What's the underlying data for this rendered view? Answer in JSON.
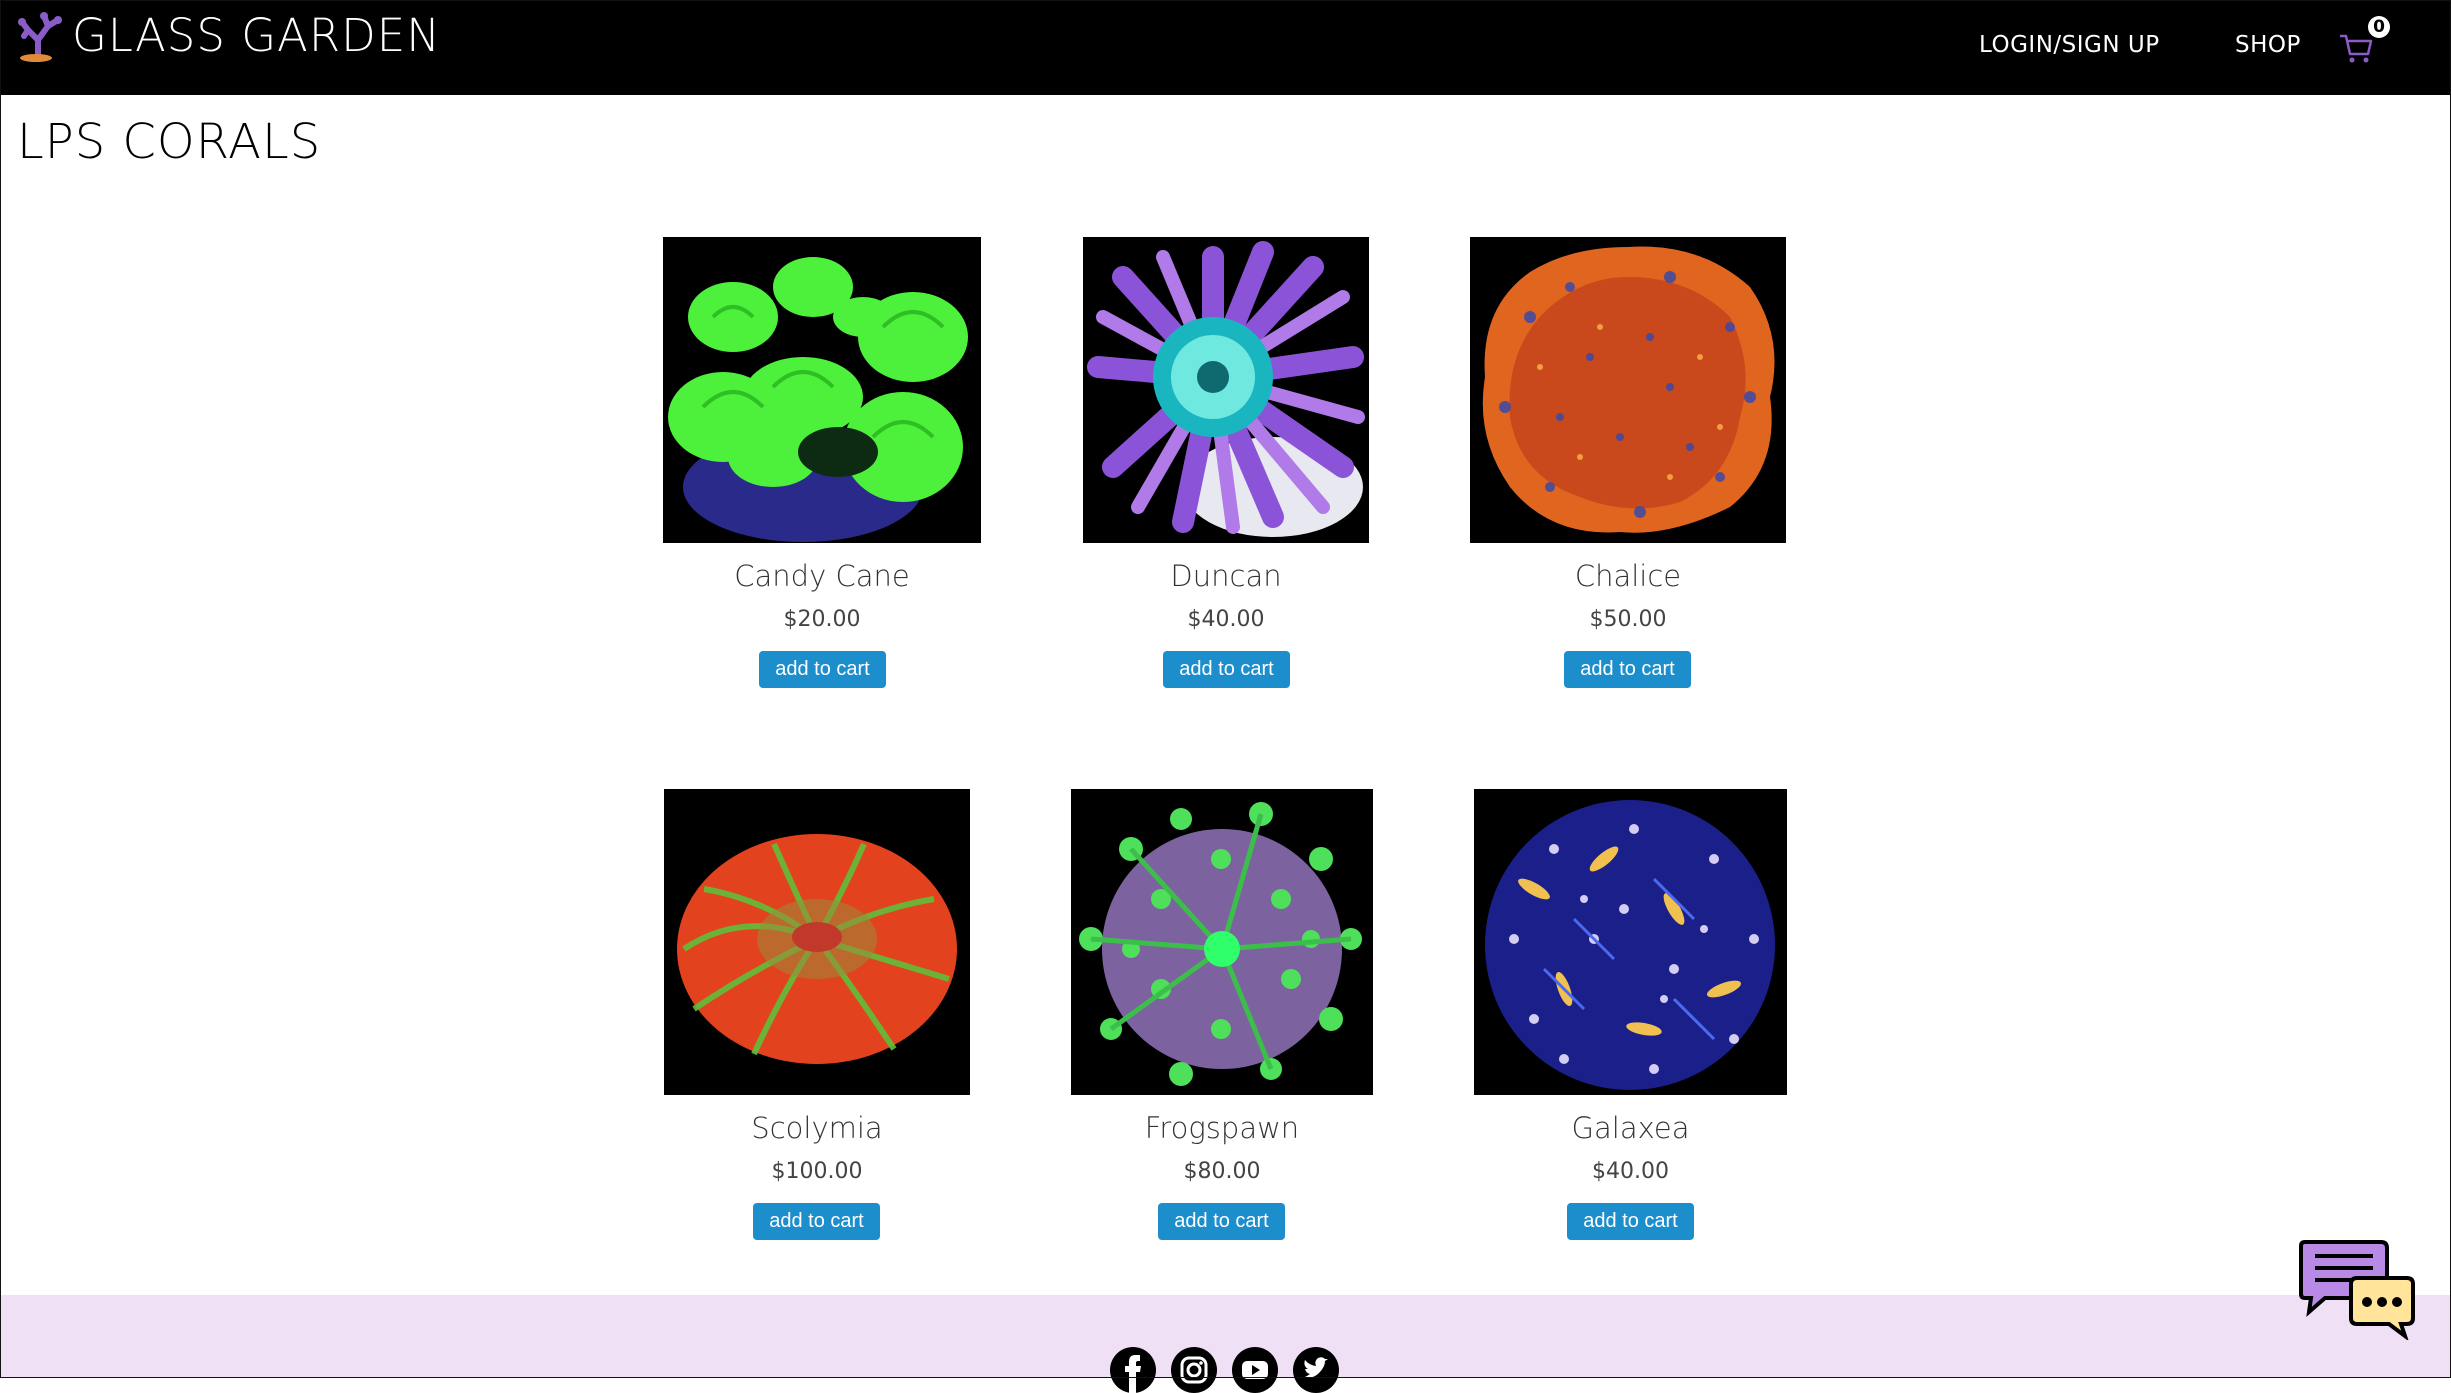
{
  "header": {
    "brand": "GLASS GARDEN",
    "nav": {
      "login": "LOGIN/SIGN UP",
      "shop": "SHOP"
    },
    "cart_count": "0"
  },
  "page": {
    "title": "LPS CORALS"
  },
  "products": [
    {
      "name": "Candy Cane",
      "price": "$20.00",
      "button": "add to cart"
    },
    {
      "name": "Duncan",
      "price": "$40.00",
      "button": "add to cart"
    },
    {
      "name": "Chalice",
      "price": "$50.00",
      "button": "add to cart"
    },
    {
      "name": "Scolymia",
      "price": "$100.00",
      "button": "add to cart"
    },
    {
      "name": "Frogspawn",
      "price": "$80.00",
      "button": "add to cart"
    },
    {
      "name": "Galaxea",
      "price": "$40.00",
      "button": "add to cart"
    }
  ],
  "footer": {
    "social": [
      "facebook-icon",
      "instagram-icon",
      "youtube-icon",
      "twitter-icon"
    ]
  },
  "colors": {
    "header_bg": "#000000",
    "button_bg": "#1d8ecc",
    "footer_bg": "#efe0f5",
    "brand_accent": "#8a5cc7"
  }
}
